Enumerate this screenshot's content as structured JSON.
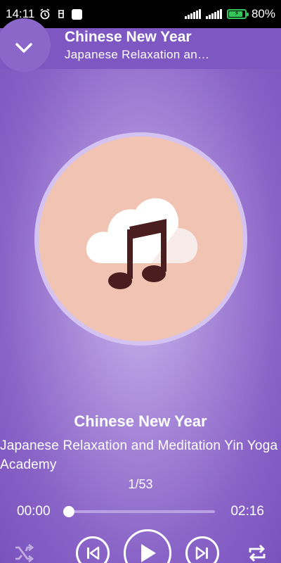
{
  "status_bar": {
    "time": "14:11",
    "battery": "80%"
  },
  "header": {
    "title": "Chinese New Year",
    "subtitle": "Japanese Relaxation an…"
  },
  "track": {
    "title": "Chinese New Year",
    "artist": "Japanese Relaxation and Meditation Yin Yoga Academy",
    "index": "1/53"
  },
  "progress": {
    "current": "00:00",
    "total": "02:16",
    "fraction": 0.0
  },
  "icons": {
    "collapse": "chevron-down-icon",
    "shuffle": "shuffle-icon",
    "previous": "skip-previous-icon",
    "play": "play-icon",
    "next": "skip-next-icon",
    "repeat": "repeat-icon",
    "album_art": "cloud-music-note-icon"
  },
  "colors": {
    "header_bg": "#7e57c2",
    "art_disc": "#f1c3b3",
    "battery": "#34c759"
  }
}
